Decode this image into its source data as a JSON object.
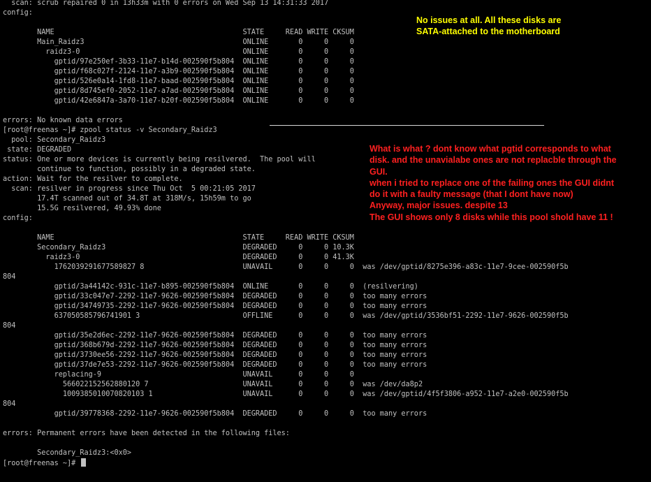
{
  "terminal": {
    "lines": [
      "  scan: scrub repaired 0 in 13h33m with 0 errors on Wed Sep 13 14:31:33 2017",
      "config:",
      "",
      "        NAME                                            STATE     READ WRITE CKSUM",
      "        Main_Raidz3                                     ONLINE       0     0     0",
      "          raidz3-0                                      ONLINE       0     0     0",
      "            gptid/97e250ef-3b33-11e7-b14d-002590f5b804  ONLINE       0     0     0",
      "            gptid/f68c027f-2124-11e7-a3b9-002590f5b804  ONLINE       0     0     0",
      "            gptid/526e0a14-1fd8-11e7-baad-002590f5b804  ONLINE       0     0     0",
      "            gptid/8d745ef0-2052-11e7-a7ad-002590f5b804  ONLINE       0     0     0",
      "            gptid/42e6847a-3a70-11e7-b20f-002590f5b804  ONLINE       0     0     0",
      "",
      "errors: No known data errors",
      "[root@freenas ~]# zpool status -v Secondary_Raidz3",
      "  pool: Secondary_Raidz3",
      " state: DEGRADED",
      "status: One or more devices is currently being resilvered.  The pool will",
      "        continue to function, possibly in a degraded state.",
      "action: Wait for the resilver to complete.",
      "  scan: resilver in progress since Thu Oct  5 00:21:05 2017",
      "        17.4T scanned out of 34.8T at 318M/s, 15h59m to go",
      "        15.5G resilvered, 49.93% done",
      "config:",
      "",
      "        NAME                                            STATE     READ WRITE CKSUM",
      "        Secondary_Raidz3                                DEGRADED     0     0 10.3K",
      "          raidz3-0                                      DEGRADED     0     0 41.3K",
      "            1762039291677589827 8                       UNAVAIL      0     0     0  was /dev/gptid/8275e396-a83c-11e7-9cee-002590f5b",
      "804",
      "            gptid/3a44142c-931c-11e7-b895-002590f5b804  ONLINE       0     0     0  (resilvering)",
      "            gptid/33c047e7-2292-11e7-9626-002590f5b804  DEGRADED     0     0     0  too many errors",
      "            gptid/34749735-2292-11e7-9626-002590f5b804  DEGRADED     0     0     0  too many errors",
      "            637050585796741901 3                        OFFLINE      0     0     0  was /dev/gptid/3536bf51-2292-11e7-9626-002590f5b",
      "804",
      "            gptid/35e2d6ec-2292-11e7-9626-002590f5b804  DEGRADED     0     0     0  too many errors",
      "            gptid/368b679d-2292-11e7-9626-002590f5b804  DEGRADED     0     0     0  too many errors",
      "            gptid/3730ee56-2292-11e7-9626-002590f5b804  DEGRADED     0     0     0  too many errors",
      "            gptid/37de7e53-2292-11e7-9626-002590f5b804  DEGRADED     0     0     0  too many errors",
      "            replacing-9                                 UNAVAIL      0     0     0",
      "              566022152562880120 7                      UNAVAIL      0     0     0  was /dev/da8p2",
      "              1009385010070820103 1                     UNAVAIL      0     0     0  was /dev/gptid/4f5f3806-a952-11e7-a2e0-002590f5b",
      "804",
      "            gptid/39778368-2292-11e7-9626-002590f5b804  DEGRADED     0     0     0  too many errors",
      "",
      "errors: Permanent errors have been detected in the following files:",
      "",
      "        Secondary_Raidz3:<0x0>",
      "[root@freenas ~]# "
    ]
  },
  "annotations": {
    "note_yellow": "No issues at all. All these disks are\nSATA-attached to the motherboard",
    "note_red": "What is what ? dont know what pgtid corresponds to what\ndisk. and the unavialabe ones are not replacble through the\nGUI.\nwhen i tried to replace one of the failing ones the GUI didnt\ndo it with a faulty message (that I dont have now)\nAnyway, major issues. despite 13\nThe GUI shows only 8 disks while this pool shold have 11 !"
  },
  "colors": {
    "background": "#000000",
    "terminal_text": "#c0c0c0",
    "note_yellow": "#ffff00",
    "note_red": "#ff2020"
  }
}
